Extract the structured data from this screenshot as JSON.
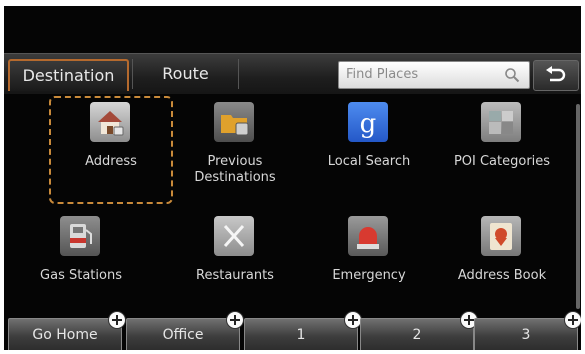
{
  "tabs": {
    "destination": "Destination",
    "route": "Route"
  },
  "search": {
    "placeholder": "Find Places"
  },
  "menu_items": [
    {
      "label": "Address",
      "icon": "house-icon"
    },
    {
      "label": "Previous Destinations",
      "icon": "folder-icon"
    },
    {
      "label": "Local Search",
      "icon": "google-icon"
    },
    {
      "label": "POI Categories",
      "icon": "poi-icon"
    },
    {
      "label": "Gas Stations",
      "icon": "gas-pump-icon"
    },
    {
      "label": "Restaurants",
      "icon": "fork-knife-icon"
    },
    {
      "label": "Emergency",
      "icon": "siren-icon"
    },
    {
      "label": "Address Book",
      "icon": "address-book-icon"
    }
  ],
  "quick_buttons": [
    "Go Home",
    "Office",
    "1",
    "2",
    "3"
  ],
  "colors": {
    "accent": "#c98a3a",
    "background": "#050505",
    "text": "#d8d8d8"
  }
}
